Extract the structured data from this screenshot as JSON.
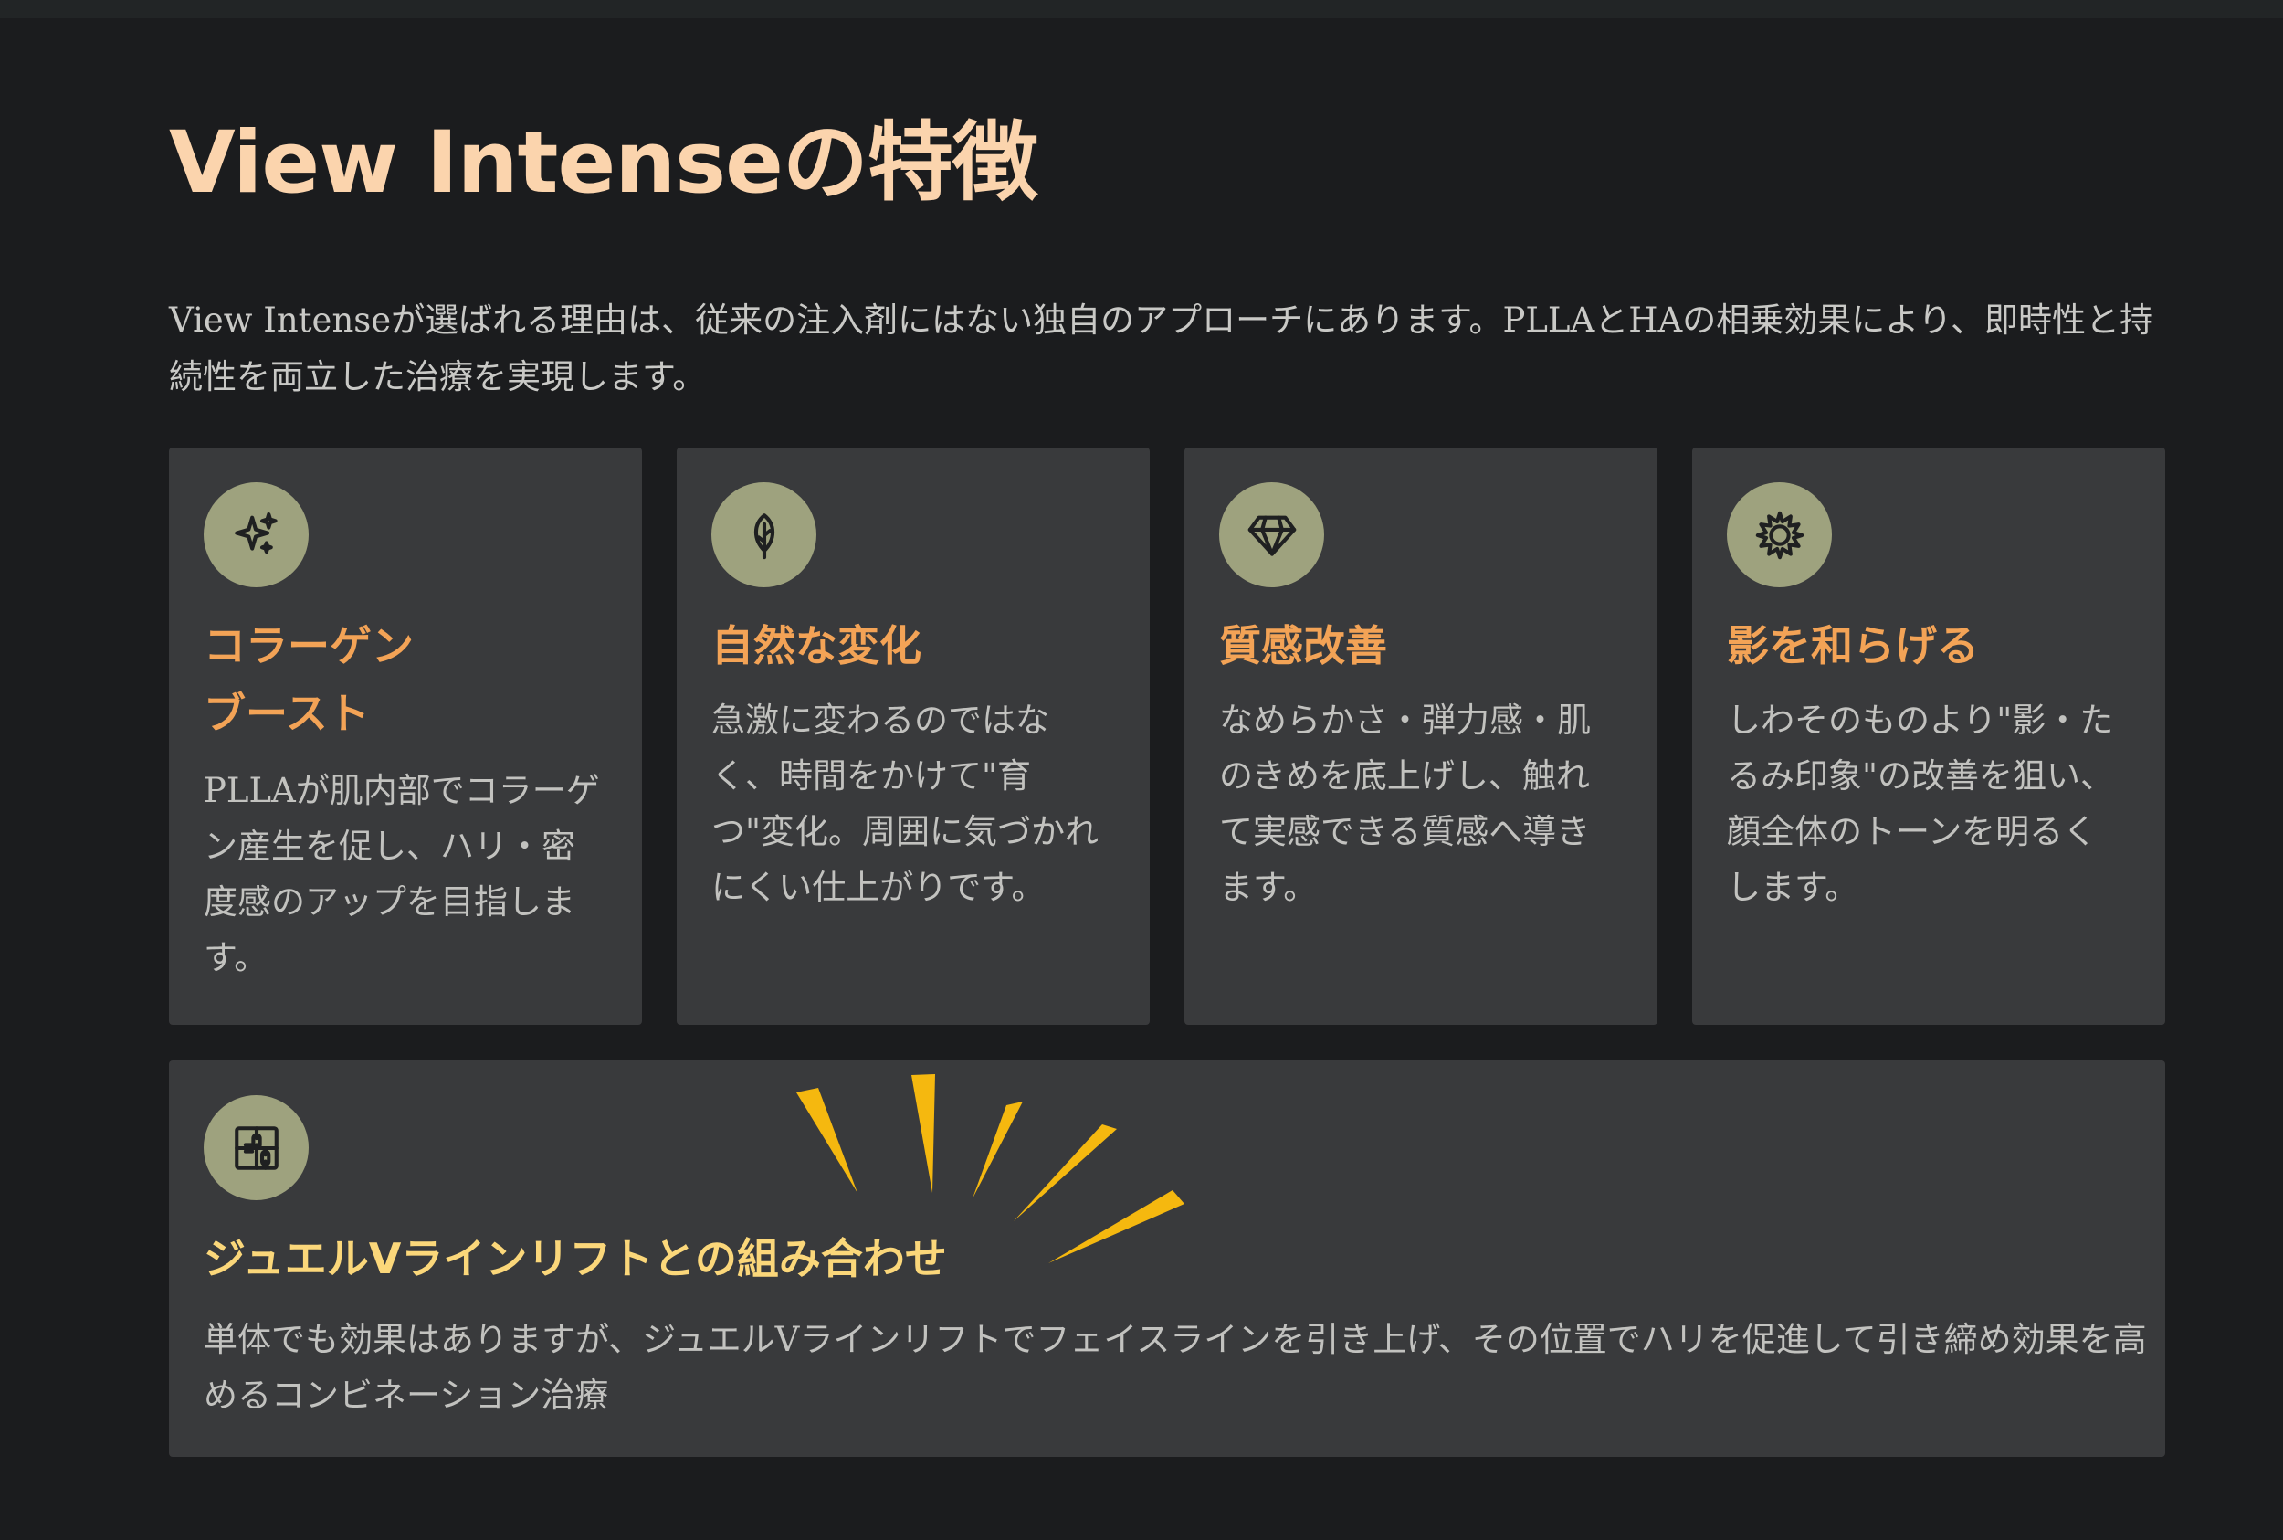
{
  "header": {
    "title": "View Intenseの特徴"
  },
  "intro": {
    "text": "View Intenseが選ばれる理由は、従来の注入剤にはない独自のアプローチにあります。PLLAとHAの相乗効果により、即時性と持続性を両立した治療を実現します。"
  },
  "features": [
    {
      "icon": "sparkles-icon",
      "title": "コラーゲン\nブースト",
      "body": "PLLAが肌内部でコラーゲン産生を促し、ハリ・密度感のアップを目指します。"
    },
    {
      "icon": "leaf-icon",
      "title": "自然な変化",
      "body": "急激に変わるのではなく、時間をかけて\"育つ\"変化。周囲に気づかれにくい仕上がりです。"
    },
    {
      "icon": "diamond-icon",
      "title": "質感改善",
      "body": "なめらかさ・弾力感・肌のきめを底上げし、触れて実感できる質感へ導きます。"
    },
    {
      "icon": "sun-icon",
      "title": "影を和らげる",
      "body": "しわそのものより\"影・たるみ印象\"の改善を狙い、顔全体のトーンを明るくします。"
    }
  ],
  "combination": {
    "icon": "puzzle-icon",
    "title": "ジュエルVラインリフトとの組み合わせ",
    "body": "単体でも効果はありますが、ジュエルVラインリフトでフェイスラインを引き上げ、その位置でハリを促進して引き締め効果を高めるコンビネーション治療"
  },
  "colors": {
    "background": "#1b1c1e",
    "card": "#393a3c",
    "title": "#fbd4ad",
    "card_title": "#f3a356",
    "combination_title": "#fbd77a",
    "icon_circle": "#9ea27e",
    "burst": "#f5b80f"
  }
}
